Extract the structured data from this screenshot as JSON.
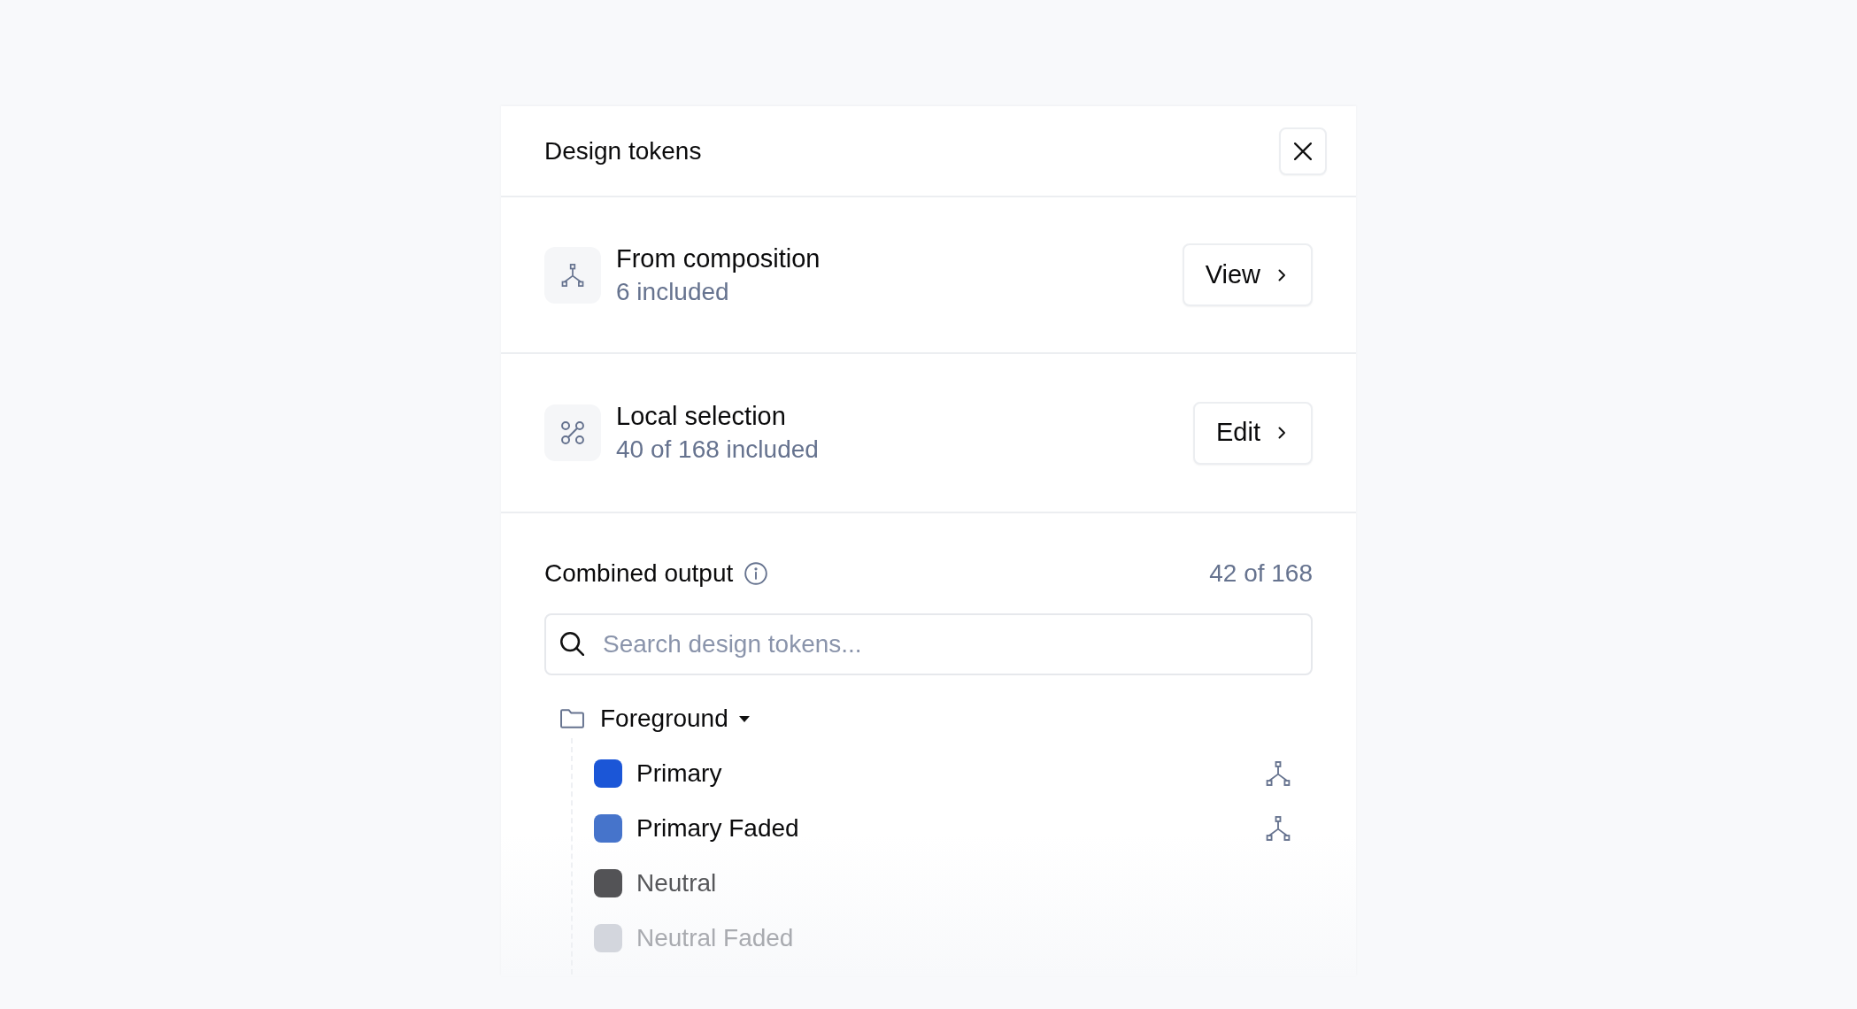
{
  "panel": {
    "title": "Design tokens"
  },
  "sources": [
    {
      "kind": "composition",
      "title": "From composition",
      "subtitle": "6 included",
      "action": "View"
    },
    {
      "kind": "selection",
      "title": "Local selection",
      "subtitle": "40 of 168 included",
      "action": "Edit"
    }
  ],
  "combined_output": {
    "title": "Combined output",
    "count": "42 of 168",
    "search": {
      "placeholder": "Search design tokens..."
    },
    "groups": [
      {
        "label": "Foreground",
        "expanded": true,
        "children": [
          {
            "label": "Primary",
            "color": "#1b56d7",
            "composition": true
          },
          {
            "label": "Primary Faded",
            "color": "#4674cb",
            "composition": true
          },
          {
            "label": "Neutral",
            "color": "#535356",
            "composition": false
          },
          {
            "label": "Neutral Faded",
            "color": "#d3d6dd",
            "composition": false
          }
        ]
      }
    ]
  }
}
